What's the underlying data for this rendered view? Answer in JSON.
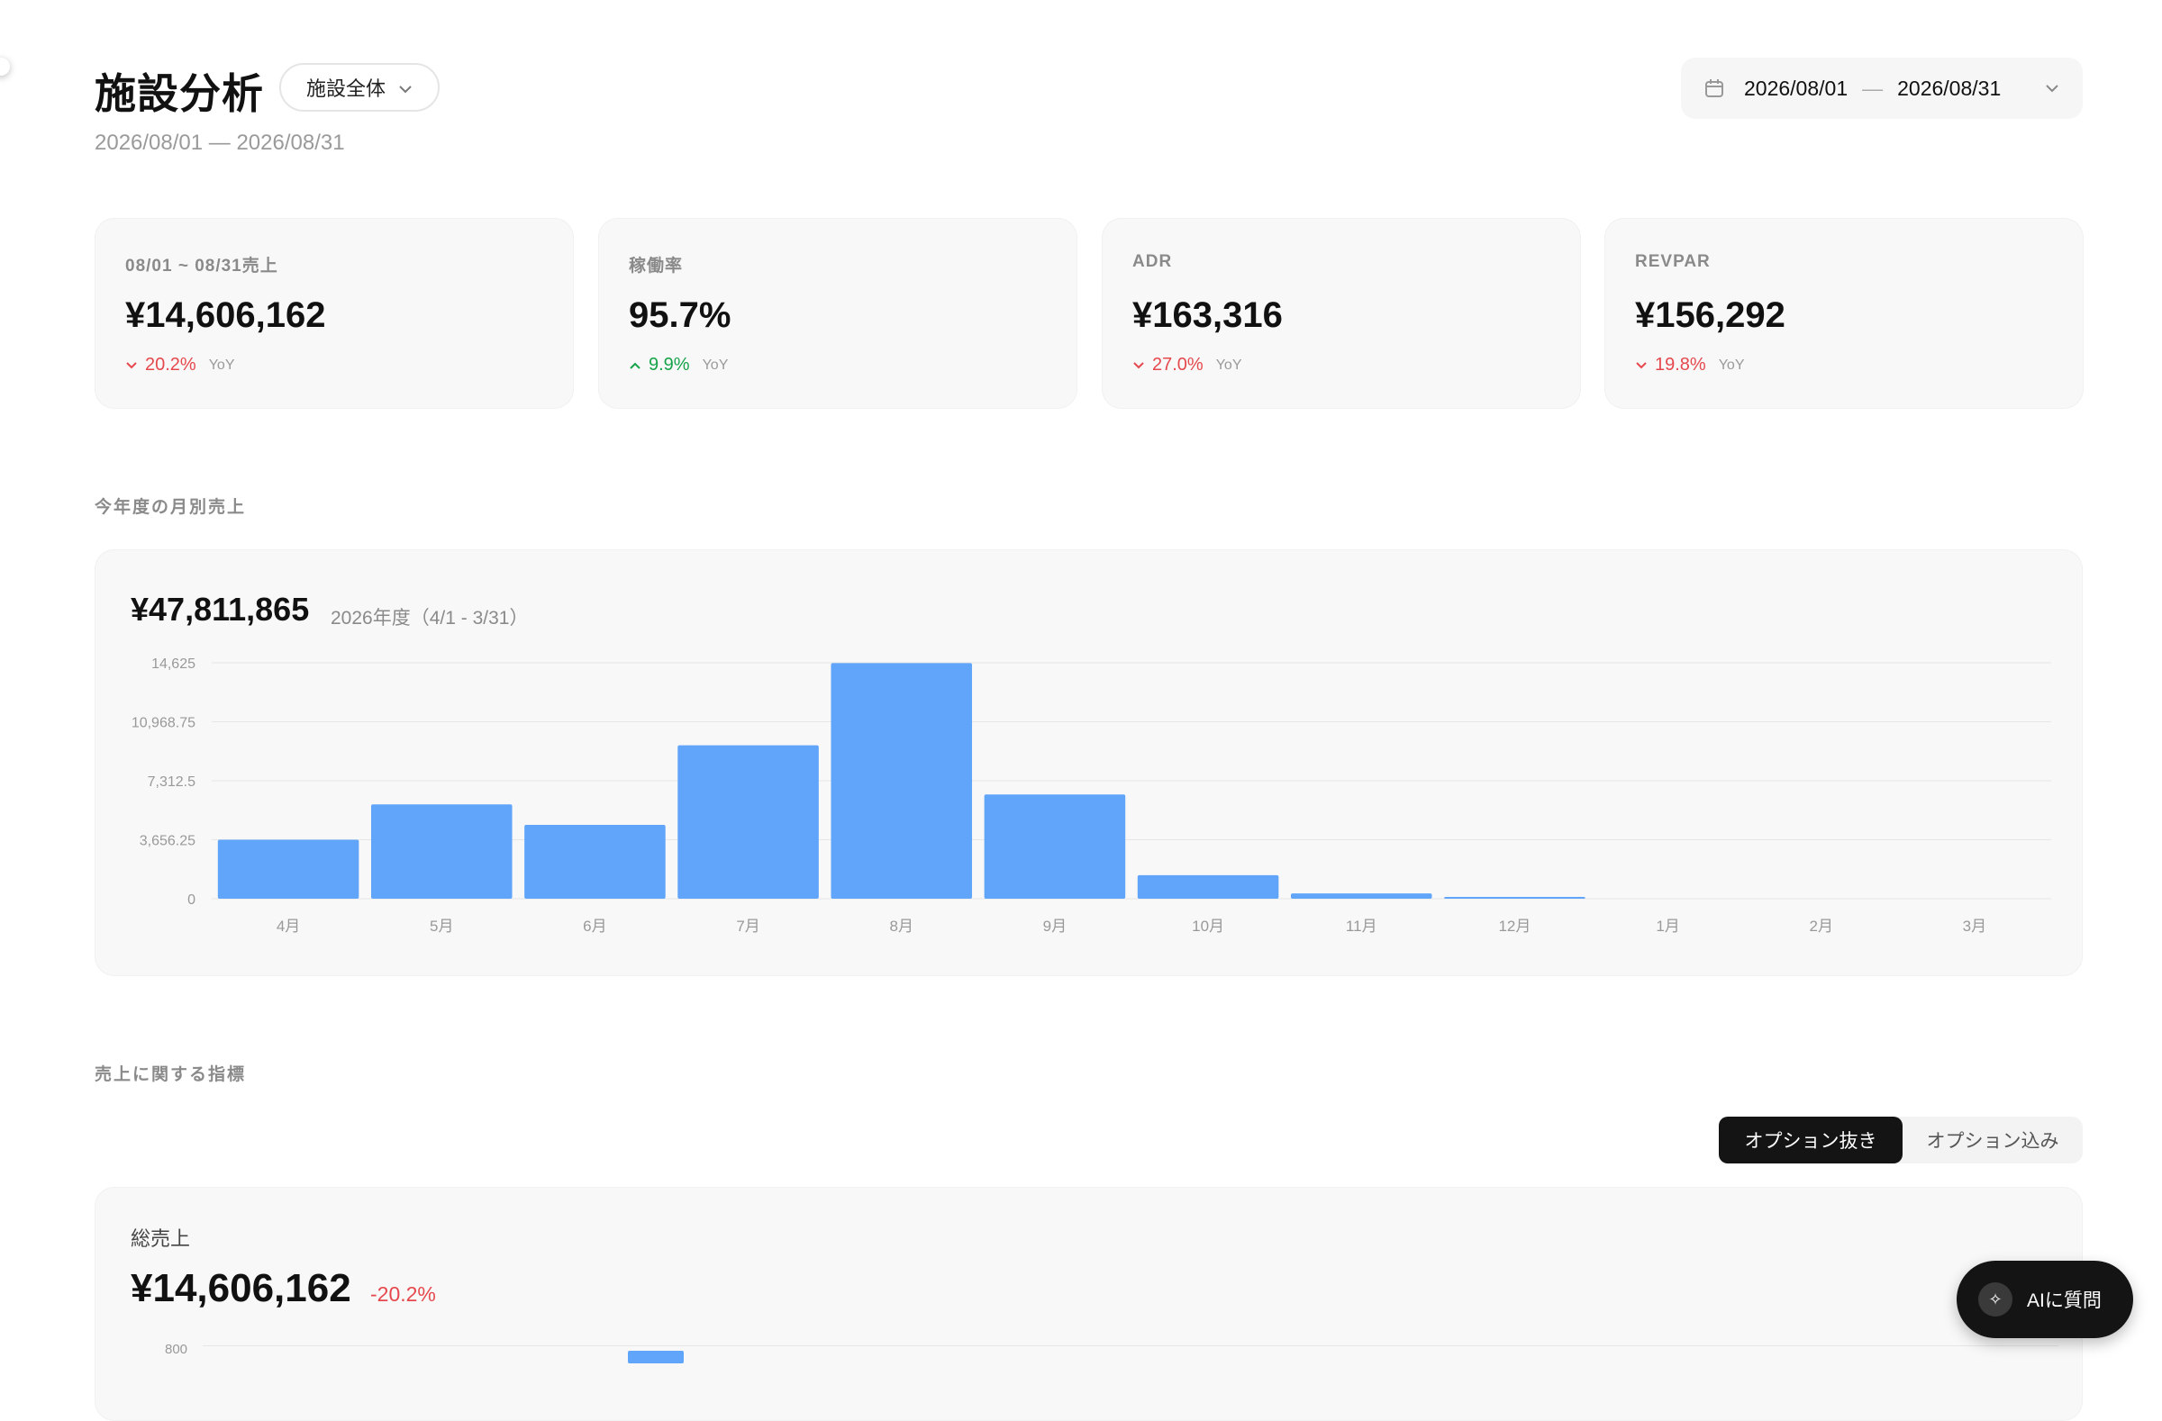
{
  "header": {
    "title": "施設分析",
    "scope_label": "施設全体",
    "subtitle": "2026/08/01 — 2026/08/31"
  },
  "date_range": {
    "start": "2026/08/01",
    "separator": "—",
    "end": "2026/08/31"
  },
  "kpis": [
    {
      "label": "08/01 ~ 08/31売上",
      "value": "¥14,606,162",
      "delta": "20.2%",
      "direction": "down",
      "yoy": "YoY"
    },
    {
      "label": "稼働率",
      "value": "95.7%",
      "delta": "9.9%",
      "direction": "up",
      "yoy": "YoY"
    },
    {
      "label": "ADR",
      "value": "¥163,316",
      "delta": "27.0%",
      "direction": "down",
      "yoy": "YoY"
    },
    {
      "label": "REVPAR",
      "value": "¥156,292",
      "delta": "19.8%",
      "direction": "down",
      "yoy": "YoY"
    }
  ],
  "monthly_section": {
    "label": "今年度の月別売上",
    "total": "¥47,811,865",
    "period": "2026年度（4/1 - 3/31）"
  },
  "chart_data": {
    "type": "bar",
    "categories": [
      "4月",
      "5月",
      "6月",
      "7月",
      "8月",
      "9月",
      "10月",
      "11月",
      "12月",
      "1月",
      "2月",
      "3月"
    ],
    "values": [
      3656,
      5850,
      4580,
      9510,
      14606,
      6460,
      1460,
      330,
      60,
      0,
      0,
      0
    ],
    "y_ticks": [
      "14,625",
      "10,968.75",
      "7,312.5",
      "3,656.25",
      "0"
    ],
    "ylim": [
      0,
      14625
    ],
    "bar_color": "#60a5fa",
    "grid": true
  },
  "metrics_section": {
    "label": "売上に関する指標",
    "toggle": {
      "active": "オプション抜き",
      "inactive": "オプション込み"
    }
  },
  "total_sales": {
    "label": "総売上",
    "value": "¥14,606,162",
    "delta": "-20.2%",
    "tick": "800"
  },
  "ai_button": {
    "label": "AIに質問"
  },
  "colors": {
    "accent": "#60a5fa",
    "down": "#e5484d",
    "up": "#16a34a"
  }
}
